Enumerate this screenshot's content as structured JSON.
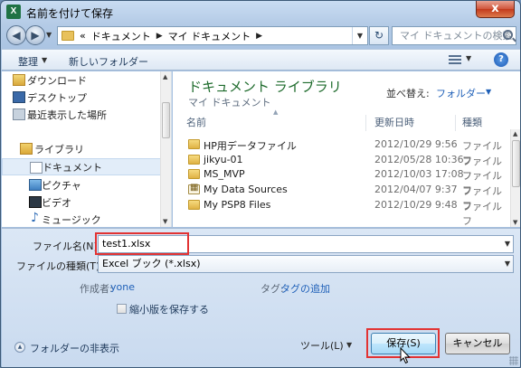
{
  "window": {
    "title": "名前を付けて保存",
    "app_icon": "excel-icon",
    "close_label": "x"
  },
  "address": {
    "prefix": "«",
    "crumbs": [
      "ドキュメント",
      "マイ ドキュメント"
    ],
    "search_placeholder": "マイ ドキュメントの検索"
  },
  "toolbar": {
    "organize": "整理",
    "new_folder": "新しいフォルダー"
  },
  "nav": {
    "items": [
      {
        "label": "ダウンロード",
        "icon": "download-folder-icon"
      },
      {
        "label": "デスクトップ",
        "icon": "desktop-icon"
      },
      {
        "label": "最近表示した場所",
        "icon": "recent-places-icon"
      },
      {
        "label": "ライブラリ",
        "icon": "library-icon"
      },
      {
        "label": "ドキュメント",
        "icon": "documents-icon"
      },
      {
        "label": "ピクチャ",
        "icon": "pictures-icon"
      },
      {
        "label": "ビデオ",
        "icon": "videos-icon"
      },
      {
        "label": "ミュージック",
        "icon": "music-icon"
      }
    ],
    "selected": "ドキュメント"
  },
  "content": {
    "library_title": "ドキュメント ライブラリ",
    "library_subtitle": "マイ ドキュメント",
    "arrange_label": "並べ替え:",
    "arrange_value": "フォルダー",
    "columns": {
      "name": "名前",
      "date": "更新日時",
      "type": "種類"
    },
    "files": [
      {
        "name": "HP用データファイル",
        "date": "2012/10/29 9:56",
        "type": "ファイル フ",
        "icon": "folder-icon"
      },
      {
        "name": "jikyu-01",
        "date": "2012/05/28 10:36",
        "type": "ファイル フ",
        "icon": "folder-icon"
      },
      {
        "name": "MS_MVP",
        "date": "2012/10/03 17:08",
        "type": "ファイル フ",
        "icon": "folder-icon"
      },
      {
        "name": "My Data Sources",
        "date": "2012/04/07 9:37",
        "type": "ファイル フ",
        "icon": "data-sources-icon"
      },
      {
        "name": "My PSP8 Files",
        "date": "2012/10/29 9:48",
        "type": "ファイル フ",
        "icon": "folder-icon"
      }
    ]
  },
  "form": {
    "filename_label": "ファイル名(N):",
    "filename_value": "test1.xlsx",
    "filetype_label": "ファイルの種類(T):",
    "filetype_value": "Excel ブック (*.xlsx)",
    "author_label": "作成者:",
    "author_value": "yone",
    "tags_label": "タグ:",
    "tags_value": "タグの追加",
    "thumbnail_label": "縮小版を保存する",
    "hide_folders": "フォルダーの非表示",
    "tools": "ツール(L)",
    "save": "保存(S)",
    "cancel": "キャンセル"
  },
  "colors": {
    "library_title": "#1e6b2c",
    "link": "#1f60b8",
    "highlight": "#e23333"
  }
}
